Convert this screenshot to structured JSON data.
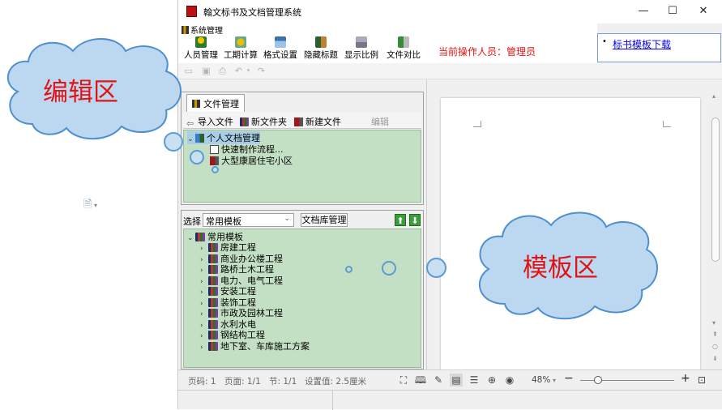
{
  "window": {
    "title": "翰文标书及文档管理系统",
    "minimize": "—",
    "maximize": "☐",
    "close": "✕"
  },
  "menu": {
    "system": "系统管理"
  },
  "toolbar": {
    "items": [
      {
        "label": "人员管理"
      },
      {
        "label": "工期计算"
      },
      {
        "label": "格式设置"
      },
      {
        "label": "隐藏标题"
      },
      {
        "label": "显示比例"
      },
      {
        "label": "文件对比"
      }
    ],
    "operator": "当前操作人员：管理员"
  },
  "link": {
    "bullet": "•",
    "text": "标书模板下载"
  },
  "file_panel": {
    "tab": "文件管理",
    "actions": {
      "import": "导入文件",
      "new_folder": "新文件夹",
      "new_file": "新建文件",
      "edit": "编辑"
    },
    "tree": {
      "root": "个人文档管理",
      "child1": "快速制作流程...",
      "child2": "大型康居住宅小区"
    }
  },
  "template_panel": {
    "select_label": "选择",
    "select_value": "常用模板",
    "library_button": "文档库管理",
    "root": "常用模板",
    "items": [
      "房建工程",
      "商业办公楼工程",
      "路桥土木工程",
      "电力、电气工程",
      "安装工程",
      "装饰工程",
      "市政及园林工程",
      "水利水电",
      "钢结构工程",
      "地下室、车库施工方案"
    ]
  },
  "status": {
    "page": "页码: 1",
    "pages": "页面: 1/1",
    "section": "节: 1/1",
    "setting": "设置值: 2.5厘米",
    "zoom": "48%",
    "zoom_minus": "−",
    "zoom_plus": "+"
  },
  "annotations": {
    "edit_area": "编辑区",
    "template_area": "模板区"
  },
  "colors": {
    "annotation_text": "#e01414",
    "cloud_fill": "#bcd8f0",
    "cloud_stroke": "#4f8fcf",
    "tree_bg": "#c4e0c4"
  }
}
